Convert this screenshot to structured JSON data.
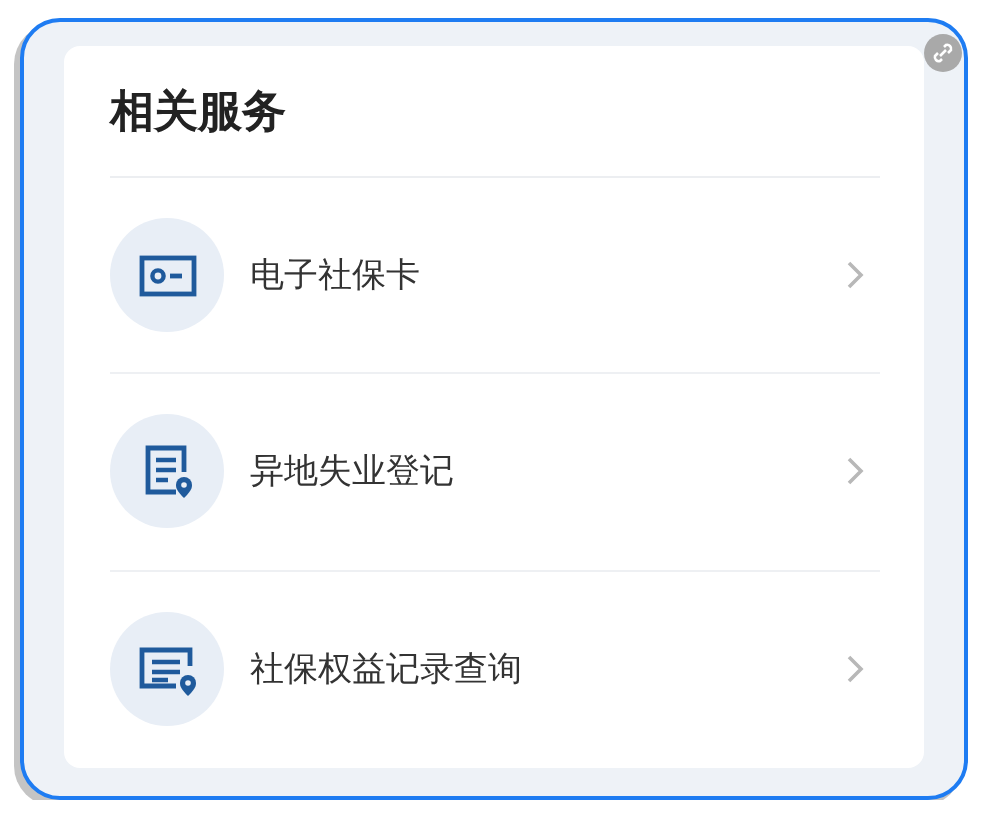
{
  "section": {
    "title": "相关服务"
  },
  "services": [
    {
      "label": "电子社保卡"
    },
    {
      "label": "异地失业登记"
    },
    {
      "label": "社保权益记录查询"
    }
  ]
}
